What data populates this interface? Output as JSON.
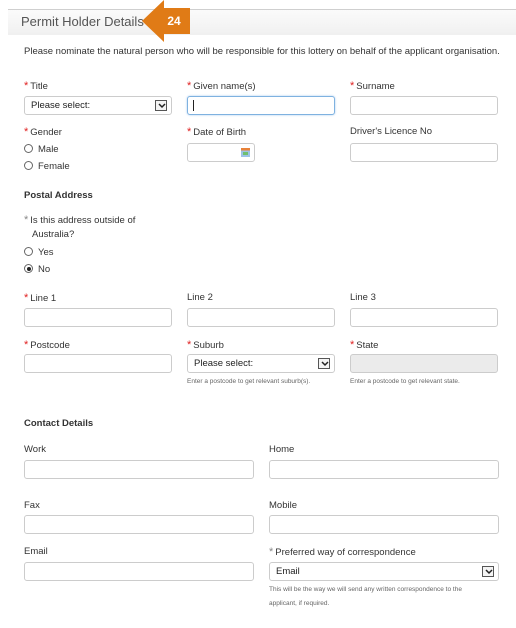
{
  "header": {
    "title": "Permit Holder Details",
    "callout_number": "24",
    "callout_color": "#e07b16"
  },
  "intro": "Please nominate the natural person who will be responsible for this lottery on behalf of the applicant organisation.",
  "required_marker": "*",
  "person": {
    "title": {
      "label": "Title",
      "value": "Please select:"
    },
    "given_names": {
      "label": "Given name(s)",
      "value": ""
    },
    "surname": {
      "label": "Surname",
      "value": ""
    },
    "gender": {
      "label": "Gender",
      "options": [
        "Male",
        "Female"
      ]
    },
    "dob": {
      "label": "Date of Birth",
      "value": ""
    },
    "licence": {
      "label": "Driver's Licence No",
      "value": ""
    }
  },
  "postal": {
    "section_title": "Postal Address",
    "outside_question_line1": "Is this address outside of",
    "outside_question_line2": "Australia?",
    "outside_options": [
      "Yes",
      "No"
    ],
    "outside_selected": "No",
    "line1": {
      "label": "Line 1",
      "value": ""
    },
    "line2": {
      "label": "Line 2",
      "value": ""
    },
    "line3": {
      "label": "Line 3",
      "value": ""
    },
    "postcode": {
      "label": "Postcode",
      "value": ""
    },
    "suburb": {
      "label": "Suburb",
      "value": "Please select:",
      "hint": "Enter a postcode to get relevant suburb(s)."
    },
    "state": {
      "label": "State",
      "value": "",
      "hint": "Enter a postcode to get relevant state."
    }
  },
  "contact": {
    "section_title": "Contact Details",
    "work": {
      "label": "Work",
      "value": ""
    },
    "home": {
      "label": "Home",
      "value": ""
    },
    "fax": {
      "label": "Fax",
      "value": ""
    },
    "mobile": {
      "label": "Mobile",
      "value": ""
    },
    "email": {
      "label": "Email",
      "value": ""
    },
    "preferred": {
      "label": "Preferred way of correspondence",
      "value": "Email",
      "hint_line1": "This will be the way we will send any written correspondence to the",
      "hint_line2": "applicant, if required."
    }
  }
}
